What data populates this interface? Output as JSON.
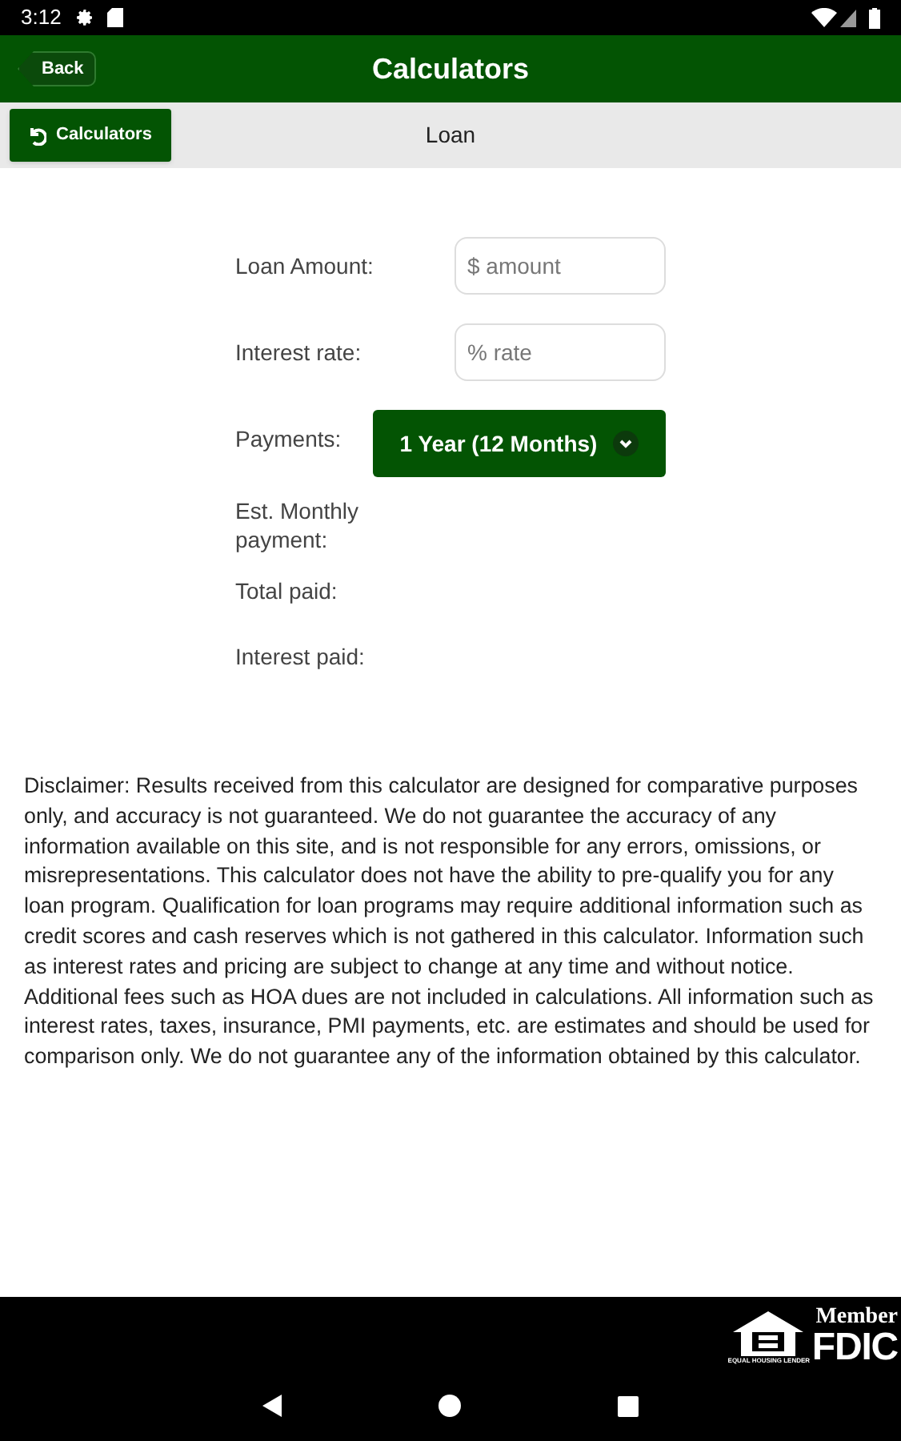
{
  "status_bar": {
    "time": "3:12"
  },
  "header": {
    "back": "Back",
    "title": "Calculators"
  },
  "subbar": {
    "button": "Calculators",
    "title": "Loan"
  },
  "form": {
    "fields": [
      {
        "kind": "input",
        "label": "Loan Amount:",
        "placeholder": "$ amount"
      },
      {
        "kind": "input",
        "label": "Interest rate:",
        "placeholder": "% rate"
      },
      {
        "kind": "select",
        "label": "Payments:",
        "value": "1 Year (12 Months)"
      },
      {
        "kind": "result",
        "label": "Est. Monthly payment:"
      },
      {
        "kind": "result",
        "label": "Total paid:"
      },
      {
        "kind": "result",
        "label": "Interest paid:"
      }
    ]
  },
  "disclaimer": "Disclaimer: Results received from this calculator are designed for comparative purposes only, and accuracy is not guaranteed. We do not guarantee the accuracy of any information available on this site, and is not responsible for any errors, omissions, or misrepresentations. This calculator does not have the ability to pre-qualify you for any loan program. Qualification for loan programs may require additional information such as credit scores and cash reserves which is not gathered in this calculator. Information such as interest rates and pricing are subject to change at any time and without notice. Additional fees such as HOA dues are not included in calculations. All information such as interest rates, taxes, insurance, PMI payments, etc. are estimates and should be used for comparison only. We do not guarantee any of the information obtained by this calculator.",
  "footer": {
    "housing_text": "EQUAL HOUSING LENDER",
    "member": "Member",
    "fdic": "FDIC"
  }
}
